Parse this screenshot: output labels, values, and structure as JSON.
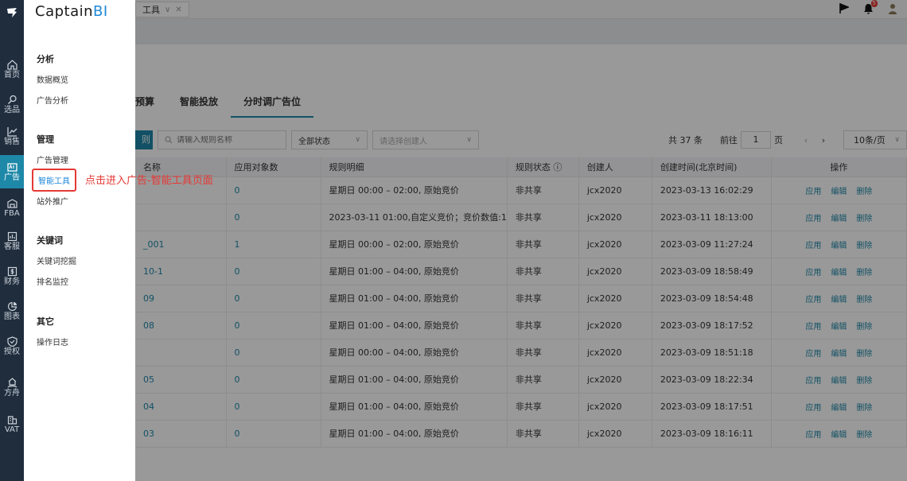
{
  "rail": {
    "items": [
      {
        "label": "首页",
        "icon": "home-icon"
      },
      {
        "label": "选品",
        "icon": "search-icon"
      },
      {
        "label": "销售",
        "icon": "chart-line-icon"
      },
      {
        "label": "广告",
        "icon": "ad-icon"
      },
      {
        "label": "FBA",
        "icon": "warehouse-icon"
      },
      {
        "label": "客服",
        "icon": "service-icon"
      },
      {
        "label": "财务",
        "icon": "dollar-icon"
      },
      {
        "label": "图表",
        "icon": "pie-icon"
      },
      {
        "label": "授权",
        "icon": "shield-icon"
      },
      {
        "label": "方舟",
        "icon": "ark-icon"
      },
      {
        "label": "VAT",
        "icon": "building-icon"
      }
    ]
  },
  "topbar": {
    "tab_label": "工具",
    "badge_count": "5"
  },
  "menu": {
    "logo_main": "Captain",
    "logo_accent": "BI",
    "sections": [
      {
        "heading": "分析",
        "links": [
          "数据概览",
          "广告分析"
        ]
      },
      {
        "heading": "管理",
        "links": [
          "广告管理",
          "智能工具",
          "站外推广"
        ]
      },
      {
        "heading": "关键词",
        "links": [
          "关键词挖掘",
          "排名监控"
        ]
      },
      {
        "heading": "其它",
        "links": [
          "操作日志"
        ]
      }
    ],
    "selected": "智能工具"
  },
  "callout": "点击进入广告-智能工具页面",
  "subtabs": [
    "预算",
    "智能投放",
    "分时调广告位"
  ],
  "toolbar": {
    "new_label": "则",
    "search_placeholder": "请输入规则名称",
    "status_select": "全部状态",
    "creator_placeholder": "请选择创建人",
    "total": "共 37 条",
    "goto_label": "前往",
    "goto_value": "1",
    "page_unit": "页",
    "page_size": "10条/页"
  },
  "table": {
    "headers": [
      "名称",
      "应用对象数",
      "规则明细",
      "规则状态 ⓘ",
      "创建人",
      "创建时间(北京时间)",
      "操作"
    ],
    "rows": [
      {
        "name": "",
        "count": "0",
        "detail": "星期日 00:00 – 02:00, 原始竞价",
        "status": "非共享",
        "creator": "jcx2020",
        "created": "2023-03-13 16:02:29"
      },
      {
        "name": "",
        "count": "0",
        "detail": "2023-03-11 01:00,自定义竞价；竞价数值:1",
        "status": "非共享",
        "creator": "jcx2020",
        "created": "2023-03-11 18:13:00"
      },
      {
        "name": "_001",
        "count": "1",
        "detail": "星期日 00:00 – 02:00, 原始竞价",
        "status": "非共享",
        "creator": "jcx2020",
        "created": "2023-03-09 11:27:24"
      },
      {
        "name": "10-1",
        "count": "0",
        "detail": "星期日 01:00 – 04:00, 原始竞价",
        "status": "非共享",
        "creator": "jcx2020",
        "created": "2023-03-09 18:58:49"
      },
      {
        "name": "09",
        "count": "0",
        "detail": "星期日 01:00 – 04:00, 原始竞价",
        "status": "非共享",
        "creator": "jcx2020",
        "created": "2023-03-09 18:54:48"
      },
      {
        "name": "08",
        "count": "0",
        "detail": "星期日 01:00 – 04:00, 原始竞价",
        "status": "非共享",
        "creator": "jcx2020",
        "created": "2023-03-09 18:17:52"
      },
      {
        "name": "",
        "count": "0",
        "detail": "星期日 00:00 – 04:00, 原始竞价",
        "status": "非共享",
        "creator": "jcx2020",
        "created": "2023-03-09 18:51:18"
      },
      {
        "name": "05",
        "count": "0",
        "detail": "星期日 01:00 – 04:00, 原始竞价",
        "status": "非共享",
        "creator": "jcx2020",
        "created": "2023-03-09 18:22:34"
      },
      {
        "name": "04",
        "count": "0",
        "detail": "星期日 01:00 – 04:00, 原始竞价",
        "status": "非共享",
        "creator": "jcx2020",
        "created": "2023-03-09 18:17:51"
      },
      {
        "name": "03",
        "count": "0",
        "detail": "星期日 01:00 – 04:00, 原始竞价",
        "status": "非共享",
        "creator": "jcx2020",
        "created": "2023-03-09 18:16:11"
      }
    ],
    "actions": [
      "应用",
      "编辑",
      "删除"
    ]
  },
  "colors": {
    "accent": "#1e88a8",
    "rail": "#1f2d3d",
    "highlight": "#e53935",
    "logo_accent": "#1e88d8"
  }
}
